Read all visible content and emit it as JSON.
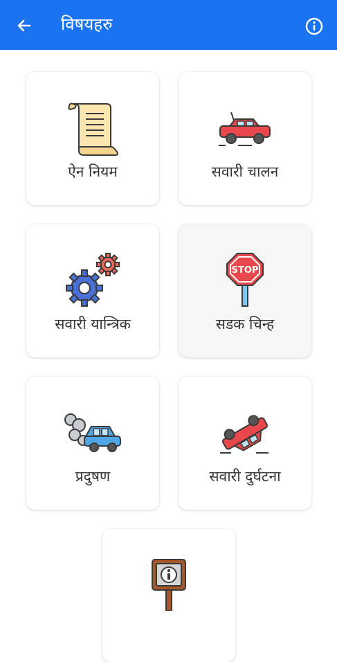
{
  "appbar": {
    "title": "विषयहरु",
    "back_icon": "arrow-left-icon",
    "info_icon": "info-circle-icon"
  },
  "topics": [
    {
      "label": "ऐन नियम",
      "icon": "scroll-icon"
    },
    {
      "label": "सवारी चालन",
      "icon": "red-car-icon"
    },
    {
      "label": "सवारी यान्त्रिक",
      "icon": "gears-icon"
    },
    {
      "label": "सडक चिन्ह",
      "icon": "stop-sign-icon"
    },
    {
      "label": "प्रदुषण",
      "icon": "polluting-car-icon"
    },
    {
      "label": "सवारी दुर्घटना",
      "icon": "car-accident-icon"
    },
    {
      "label": "",
      "icon": "info-signboard-icon"
    }
  ],
  "colors": {
    "appbar": "#1a73f0",
    "background": "#ffffff"
  }
}
